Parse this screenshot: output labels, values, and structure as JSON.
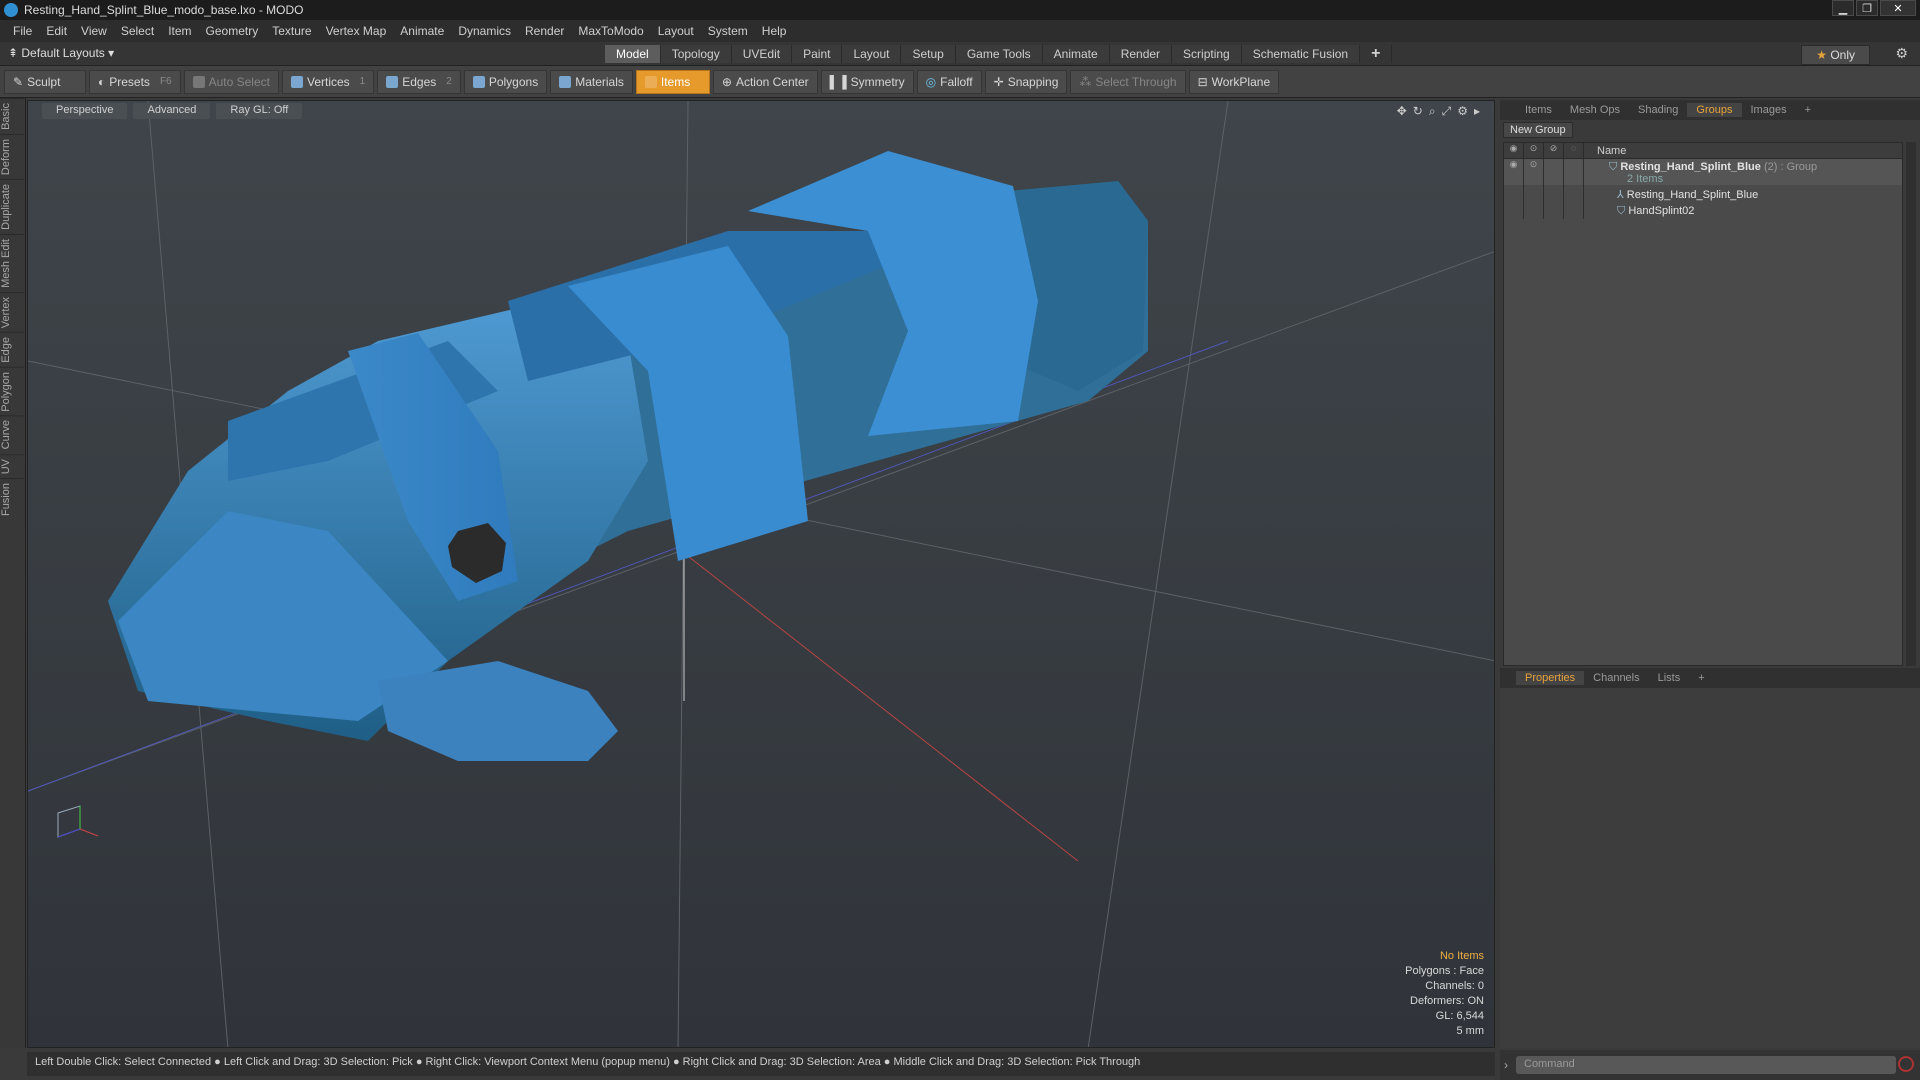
{
  "window": {
    "title": "Resting_Hand_Splint_Blue_modo_base.lxo - MODO"
  },
  "menu": [
    "File",
    "Edit",
    "View",
    "Select",
    "Item",
    "Geometry",
    "Texture",
    "Vertex Map",
    "Animate",
    "Dynamics",
    "Render",
    "MaxToModo",
    "Layout",
    "System",
    "Help"
  ],
  "layoutbar": {
    "layouts_label": "Default Layouts",
    "tabs": [
      "Model",
      "Topology",
      "UVEdit",
      "Paint",
      "Layout",
      "Setup",
      "Game Tools",
      "Animate",
      "Render",
      "Scripting",
      "Schematic Fusion"
    ],
    "active_tab": "Model",
    "plus": "+",
    "only_label": "Only"
  },
  "toolbar": {
    "sculpt": "Sculpt",
    "presets": "Presets",
    "presets_key": "F6",
    "auto_select": "Auto Select",
    "vertices": "Vertices",
    "vertices_key": "1",
    "edges": "Edges",
    "edges_key": "2",
    "polygons": "Polygons",
    "materials": "Materials",
    "items": "Items",
    "action_center": "Action Center",
    "symmetry": "Symmetry",
    "falloff": "Falloff",
    "snapping": "Snapping",
    "select_through": "Select Through",
    "workplane": "WorkPlane"
  },
  "left_tabs": [
    "Basic",
    "Deform",
    "Duplicate",
    "Mesh Edit",
    "Vertex",
    "Edge",
    "Polygon",
    "Curve",
    "UV",
    "Fusion"
  ],
  "viewport": {
    "view_mode": "Perspective",
    "shading": "Advanced",
    "raygl": "Ray GL: Off",
    "info": {
      "items": "No Items",
      "polygons": "Polygons : Face",
      "channels": "Channels: 0",
      "deformers": "Deformers: ON",
      "gl": "GL: 6,544",
      "scale": "5 mm"
    }
  },
  "statusbar": "Left Double Click: Select Connected ● Left Click and Drag: 3D Selection: Pick ● Right Click: Viewport Context Menu (popup menu) ● Right Click and Drag: 3D Selection: Area ● Middle Click and Drag: 3D Selection: Pick Through",
  "groups_panel": {
    "tabs": [
      "Items",
      "Mesh Ops",
      "Shading",
      "Groups",
      "Images",
      "+"
    ],
    "active_tab": "Groups",
    "new_group": "New Group",
    "name_header": "Name",
    "group_name": "Resting_Hand_Splint_Blue",
    "group_suffix": "(2) : Group",
    "group_count": "2 Items",
    "children": [
      "Resting_Hand_Splint_Blue",
      "HandSplint02"
    ]
  },
  "properties_panel": {
    "tabs": [
      "Properties",
      "Channels",
      "Lists",
      "+"
    ],
    "active_tab": "Properties"
  },
  "command": {
    "placeholder": "Command"
  },
  "colors": {
    "accent": "#e79a2c",
    "splint_blue": "#3f8fcf"
  }
}
